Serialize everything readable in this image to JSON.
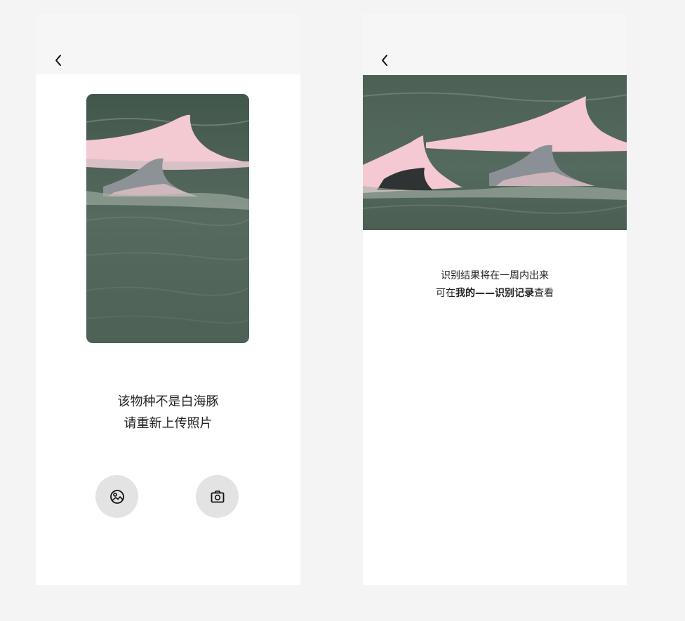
{
  "left_screen": {
    "back_icon": "chevron-left-icon",
    "photo_alt": "白海豚照片",
    "message_line1": "该物种不是白海豚",
    "message_line2": "请重新上传照片",
    "gallery_icon": "image-icon",
    "camera_icon": "camera-icon"
  },
  "right_screen": {
    "back_icon": "chevron-left-icon",
    "photo_alt": "白海豚照片",
    "message_line1": "识别结果将在一周内出来",
    "message_line2_prefix": "可在",
    "message_line2_bold": "我的——识别记录",
    "message_line2_suffix": "查看"
  },
  "colors": {
    "page_background": "#f4f4f4",
    "topbar": "#f6f6f6",
    "screen": "#ffffff",
    "button_bg": "#e3e3e3",
    "water": "#4f6156",
    "dolphin_pink": "#f2c6cf",
    "dolphin_gray": "#8a8f94"
  }
}
